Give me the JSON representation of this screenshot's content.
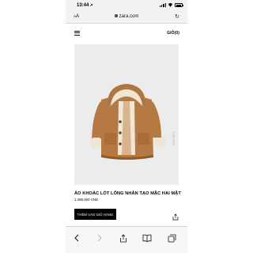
{
  "status_bar": {
    "time": "13:44",
    "location_arrow": "↗",
    "signal_bars": 4,
    "wifi_icon": "wifi-icon",
    "battery_level": 0.8
  },
  "browser": {
    "text_size_label": "AA",
    "url": "zara.com",
    "reload_icon": "↻"
  },
  "header": {
    "menu_icon": "hamburger-icon",
    "bag_label": "GIỎ(0)"
  },
  "product": {
    "image_caption_vertical": "ZARA.COM",
    "title": "ÁO KHOÁC LÓT LÔNG NHÂN TẠO MẶC HAI MẶT",
    "price": "1.399.000 VND",
    "add_to_cart_label": "THÊM VÀO GIỎ HÀNG",
    "share_icon": "share-icon"
  },
  "toolbar": {
    "items": [
      "back-icon",
      "forward-icon",
      "share-icon",
      "bookmarks-icon",
      "tabs-icon"
    ],
    "back_enabled": true,
    "forward_enabled": false
  },
  "colors": {
    "coat": "#b57a43",
    "coat_dark": "#8e5a2c",
    "shearling": "#efe6d6",
    "button_bg": "#000000",
    "chrome_bg": "#f2f2f2"
  }
}
